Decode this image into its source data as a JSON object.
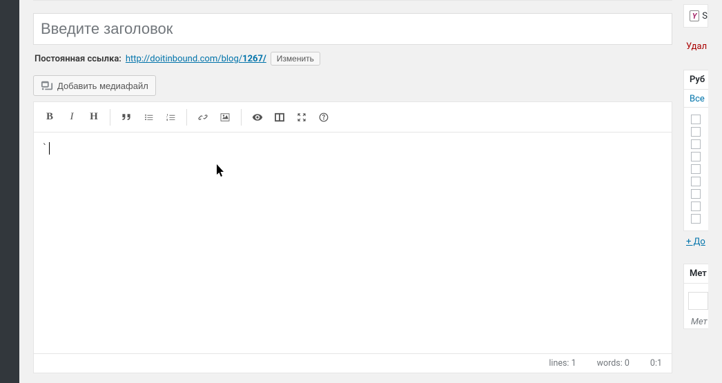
{
  "title_placeholder": "Введите заголовок",
  "permalink": {
    "label": "Постоянная ссылка:",
    "url_prefix": "http://doitinbound.com/blog/",
    "url_slug": "1267/",
    "edit_label": "Изменить"
  },
  "media_button": "Добавить медиафайл",
  "toolbar": {
    "bold": "B",
    "italic": "I",
    "heading": "H"
  },
  "editor_content": "`",
  "status": {
    "lines_label": "lines:",
    "lines_value": "1",
    "words_label": "words:",
    "words_value": "0",
    "position": "0:1"
  },
  "sidebar": {
    "yoast_letter": "Y",
    "yoast_text": "S",
    "delete": "Удал",
    "categories_heading": "Руб",
    "categories_tab": "Все",
    "add_new": "+ До",
    "tags_heading": "Мет",
    "tags_hint": "Мет"
  }
}
